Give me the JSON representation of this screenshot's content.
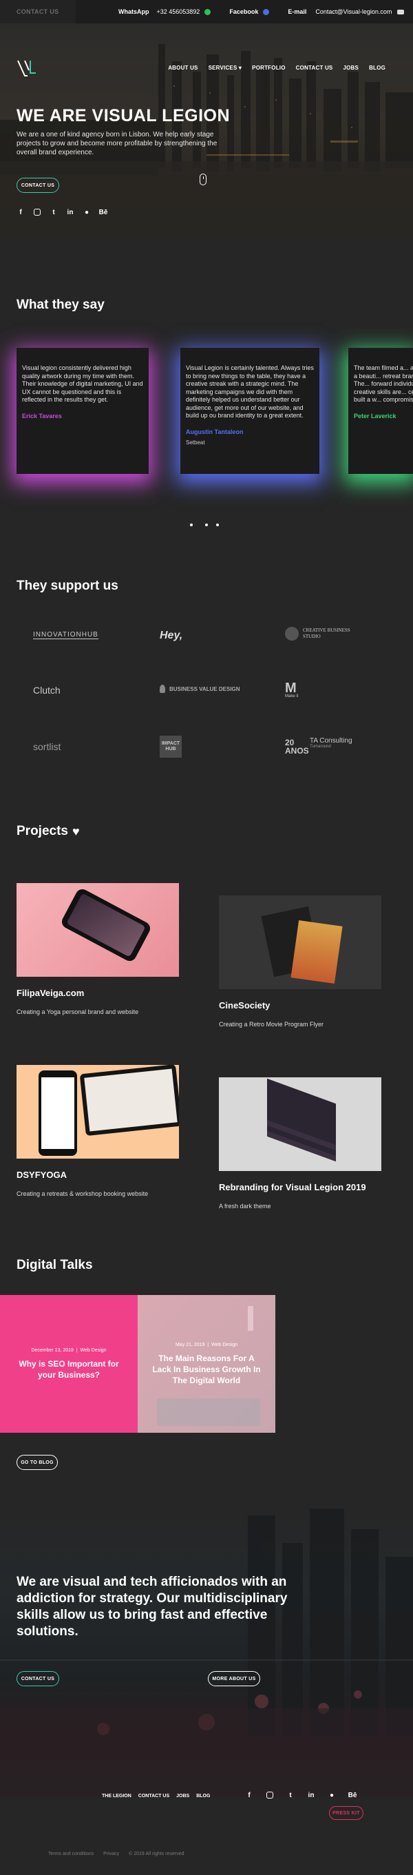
{
  "topbar": {
    "contact_tab": "CONTACT US",
    "whatsapp_label": "WhatsApp",
    "whatsapp_number": "+32 456053892",
    "facebook_label": "Facebook",
    "email_label": "E-mail",
    "email_value": "Contact@Visual-legion.com"
  },
  "nav": {
    "items": [
      "ABOUT US",
      "SERVICES ▾",
      "PORTFOLIO",
      "CONTACT US",
      "JOBS",
      "BLOG"
    ]
  },
  "hero": {
    "title": "WE ARE VISUAL LEGION",
    "text": "We are a one of kind agency born in Lisbon. We help early stage projects to grow and become more profitable by strengthening the overall brand experience.",
    "cta": "CONTACT US",
    "socials": [
      "facebook-icon",
      "instagram-icon",
      "twitter-icon",
      "linkedin-icon",
      "github-icon",
      "behance-icon"
    ]
  },
  "testimonials": {
    "title": "What they say",
    "items": [
      {
        "text": "Visual legion consistently delivered high quality artwork during my time with them. Their knowledge of digital marketing, UI and UX cannot be questioned and this is reflected in the results they get.",
        "author": "Erick Tavares",
        "company": "",
        "color": "#c64cd6"
      },
      {
        "text": "Visual Legion is certainly talented. Always tries to bring new things to the table, they have a creative streak with a strategic mind. The marketing campaigns we did with them definitely helped us understand better our audience, get more out of our website, and build up ou brand identity to a great extent.",
        "author": "Augustin Tantaleon",
        "company": "Setbeat",
        "color": "#5b6ef0"
      },
      {
        "text": "The team filmed a... and built a beauti... retreat brand. The... forward individua... creative skills are... certainly built a w... compromise here",
        "author": "Peter Laverick",
        "company": "",
        "color": "#3ed17a"
      }
    ]
  },
  "clients": {
    "title": "They support us",
    "logos": [
      "INNOVATIONHUB",
      "Hey,",
      "CREATIVE BUSINESS STUDIO",
      "Clutch",
      "BUSINESS VALUE DESIGN",
      "Make it",
      "sortlist",
      "IMPACT HUB",
      "20 ANOS",
      "TA Consulting",
      "Turnaround"
    ]
  },
  "projects": {
    "title": "Projects",
    "items": [
      {
        "title": "FilipaVeiga.com",
        "desc": "Creating a Yoga personal brand and website"
      },
      {
        "title": "CineSociety",
        "desc": "Creating a Retro Movie Program Flyer"
      },
      {
        "title": "DSYFYOGA",
        "desc": "Creating a retreats & workshop booking website"
      },
      {
        "title": "Rebranding for Visual Legion 2019",
        "desc": "A fresh dark theme"
      }
    ]
  },
  "talks": {
    "title": "Digital Talks",
    "items": [
      {
        "date": "December 13, 2019",
        "category": "Web Design",
        "title": "Why is SEO Important for your Business?"
      },
      {
        "date": "May 21, 2019",
        "category": "Web Design",
        "title": "The Main Reasons For A Lack In Business Growth In The Digital World"
      }
    ],
    "cta": "GO TO BLOG"
  },
  "about": {
    "text": "We are visual and tech afficionados with an addiction for strategy. Our multidisciplinary skills allow us to bring fast and effective solutions.",
    "cta_contact": "CONTACT US",
    "cta_more": "MORE ABOUT US"
  },
  "footer": {
    "nav": [
      "THE LEGION",
      "CONTACT US",
      "JOBS",
      "BLOG"
    ],
    "press_kit": "PRESS KIT",
    "legal": [
      "Terms and conditions",
      "Privacy",
      "© 2019 All rights reserved"
    ]
  },
  "colors": {
    "accent": "#3ec9b0",
    "press": "#e03060",
    "bg": "#262626"
  }
}
